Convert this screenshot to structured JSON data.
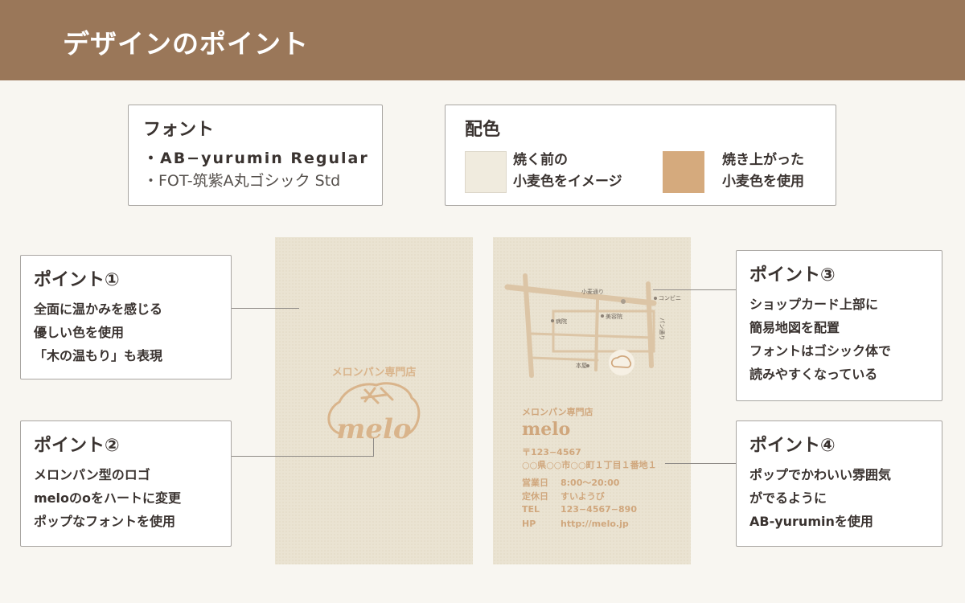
{
  "header": {
    "title": "デザインのポイント"
  },
  "font_box": {
    "title": "フォント",
    "lines": [
      "・AB−yurumin Regular",
      "・FOT-筑紫A丸ゴシック Std"
    ]
  },
  "color_box": {
    "title": "配色",
    "swatches": [
      {
        "color": "#f0ebde",
        "line1": "焼く前の",
        "line2": "小麦色をイメージ"
      },
      {
        "color": "#d5aa7d",
        "line1": "焼き上がった",
        "line2": "小麦色を使用"
      }
    ]
  },
  "points": [
    {
      "title": "ポイント①",
      "lines": [
        "全面に温かみを感じる",
        "優しい色を使用",
        "「木の温もり」も表現"
      ]
    },
    {
      "title": "ポイント②",
      "lines": [
        "メロンパン型のロゴ",
        "meloのoをハートに変更",
        "ポップなフォントを使用"
      ]
    },
    {
      "title": "ポイント③",
      "lines": [
        "ショップカード上部に",
        "簡易地図を配置",
        "フォントはゴシック体で",
        "読みやすくなっている"
      ]
    },
    {
      "title": "ポイント④",
      "lines": [
        "ポップでかわいい雰囲気",
        "がでるように",
        "AB-yuruminを使用"
      ]
    }
  ],
  "card_front": {
    "shop_label": "メロンパン専門店",
    "logo_text": "melo"
  },
  "card_back": {
    "map": {
      "road_top": "小麦通り",
      "road_right": "パン通り",
      "convenience": "コンビニ",
      "hospital": "病院",
      "salon": "美容院",
      "bookstore": "本屋"
    },
    "shop_label": "メロンパン専門店",
    "shop_name": "melo",
    "postal": "〒123−4567",
    "address": "○○県○○市○○町１丁目１番地１",
    "hours_label": "営業日",
    "hours_value": "8:00〜20:00",
    "closed_label": "定休日",
    "closed_value": "すいようび",
    "tel_label": "TEL",
    "tel_value": "123−4567−890",
    "hp_label": "HP",
    "hp_value": "http://melo.jp"
  },
  "colors": {
    "header_bg": "#9a7759",
    "card_bg": "#eae3d2",
    "accent": "#d0a77d",
    "map_road": "#dcc5a6"
  }
}
